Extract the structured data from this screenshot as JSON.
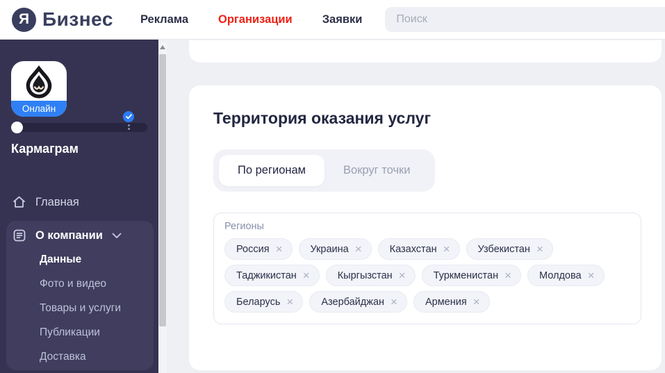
{
  "header": {
    "logo": {
      "circle_letter": "Я",
      "brand": "Бизнес"
    },
    "nav": [
      {
        "label": "Реклама",
        "active": false
      },
      {
        "label": "Организации",
        "active": true
      },
      {
        "label": "Заявки",
        "active": false
      }
    ],
    "search_placeholder": "Поиск"
  },
  "sidebar": {
    "status_badge": "Онлайн",
    "company_name": "Кармаграм",
    "items": [
      {
        "label": "Главная"
      }
    ],
    "company_group": {
      "label": "О компании",
      "expanded": true,
      "children": [
        {
          "label": "Данные",
          "active": true
        },
        {
          "label": "Фото и видео",
          "active": false
        },
        {
          "label": "Товары и услуги",
          "active": false
        },
        {
          "label": "Публикации",
          "active": false
        },
        {
          "label": "Доставка",
          "active": false
        }
      ]
    }
  },
  "main": {
    "section_title": "Территория оказания услуг",
    "tabs": [
      {
        "label": "По регионам",
        "active": true
      },
      {
        "label": "Вокруг точки",
        "active": false
      }
    ],
    "regions": {
      "label": "Регионы",
      "chips": [
        "Россия",
        "Украина",
        "Казахстан",
        "Узбекистан",
        "Таджикистан",
        "Кыргызстан",
        "Туркменистан",
        "Молдова",
        "Беларусь",
        "Азербайджан",
        "Армения"
      ]
    }
  },
  "icons": {
    "close_glyph": "×"
  },
  "colors": {
    "accent_red": "#ee2116",
    "accent_blue": "#2b7cf6",
    "online_blue": "#2f80f4",
    "sidebar_bg": "#363352",
    "sidebar_group_bg": "#403d5e",
    "brand_navy": "#3a3e5e",
    "page_bg": "#eef0f4"
  }
}
